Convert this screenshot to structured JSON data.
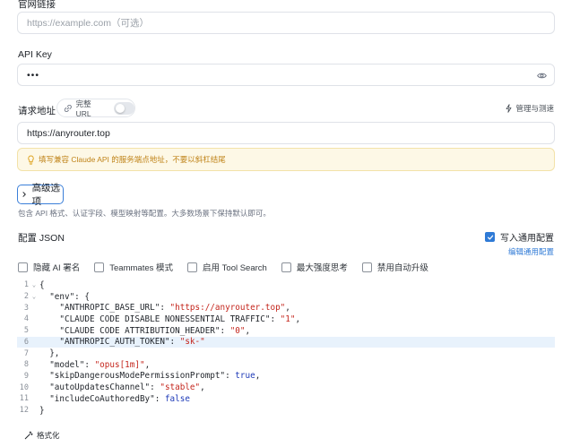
{
  "website": {
    "label": "官网链接",
    "placeholder": "https://example.com（可选）"
  },
  "api_key": {
    "label": "API Key",
    "value": "•••"
  },
  "request_url": {
    "label": "请求地址",
    "full_url_toggle_label": "完整 URL",
    "manage_label": "管理与测速",
    "value": "https://anyrouter.top"
  },
  "tip": {
    "text": "填写兼容 Claude API 的服务端点地址，不要以斜杠结尾"
  },
  "advanced": {
    "label": "高级选项",
    "description": "包含 API 格式、认证字段、模型映射等配置。大多数场景下保持默认即可。"
  },
  "config_json": {
    "title": "配置 JSON",
    "write_common_label": "写入通用配置",
    "write_common_checked": true,
    "edit_common_link": "编辑通用配置",
    "options": [
      {
        "label": "隐藏 AI 署名",
        "checked": false
      },
      {
        "label": "Teammates 模式",
        "checked": false
      },
      {
        "label": "启用 Tool Search",
        "checked": false
      },
      {
        "label": "最大强度思考",
        "checked": false
      },
      {
        "label": "禁用自动升级",
        "checked": false
      }
    ],
    "code_lines": [
      {
        "n": "1",
        "fold": "⌄"
      },
      {
        "n": "2",
        "fold": "⌄"
      },
      {
        "n": "3",
        "fold": ""
      },
      {
        "n": "4",
        "fold": ""
      },
      {
        "n": "5",
        "fold": ""
      },
      {
        "n": "6",
        "fold": ""
      },
      {
        "n": "7",
        "fold": ""
      },
      {
        "n": "8",
        "fold": ""
      },
      {
        "n": "9",
        "fold": ""
      },
      {
        "n": "10",
        "fold": ""
      },
      {
        "n": "11",
        "fold": ""
      },
      {
        "n": "12",
        "fold": ""
      }
    ],
    "code": {
      "l1": "{",
      "l2": "  \"env\": {",
      "l3_key": "    \"ANTHROPIC_BASE_URL\": ",
      "l3_val": "\"https://anyrouter.top\"",
      "l3_end": ",",
      "l4_key": "    \"CLAUDE CODE DISABLE NONESSENTIAL TRAFFIC\": ",
      "l4_val": "\"1\"",
      "l4_end": ",",
      "l5_key": "    \"CLAUDE CODE ATTRIBUTION_HEADER\": ",
      "l5_val": "\"0\"",
      "l5_end": ",",
      "l6_key": "    \"ANTHROPIC_AUTH_TOKEN\": ",
      "l6_val": "\"sk-\"",
      "l7": "  },",
      "l8_key": "  \"model\": ",
      "l8_val": "\"opus[1m]\"",
      "l8_end": ",",
      "l9_key": "  \"skipDangerousModePermissionPrompt\": ",
      "l9_val": "true",
      "l9_end": ",",
      "l10_key": "  \"autoUpdatesChannel\": ",
      "l10_val": "\"stable\"",
      "l10_end": ",",
      "l11_key": "  \"includeCoAuthoredBy\": ",
      "l11_val": "false",
      "l12": "}"
    },
    "format_label": "格式化"
  }
}
